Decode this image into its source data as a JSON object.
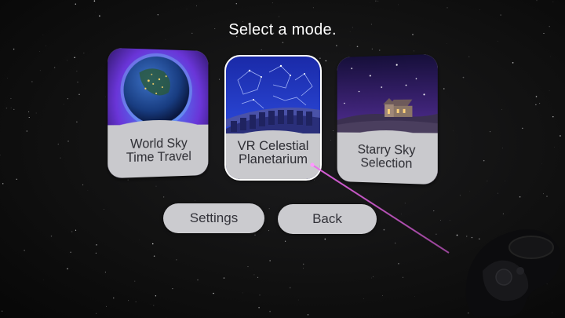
{
  "prompt": "Select a mode.",
  "modes": [
    {
      "label_line1": "World Sky",
      "label_line2": "Time Travel",
      "icon": "earth-at-night-icon"
    },
    {
      "label_line1": "VR Celestial",
      "label_line2": "Planetarium",
      "icon": "constellation-planetarium-icon",
      "selected": true
    },
    {
      "label_line1": "Starry Sky",
      "label_line2": "Selection",
      "icon": "church-under-starry-sky-icon"
    }
  ],
  "buttons": {
    "settings": "Settings",
    "back": "Back"
  },
  "colors": {
    "background": "#111111",
    "card_label_bg": "#c9c9cd",
    "button_bg": "#cbcbcf",
    "laser": "#ee66ee"
  }
}
